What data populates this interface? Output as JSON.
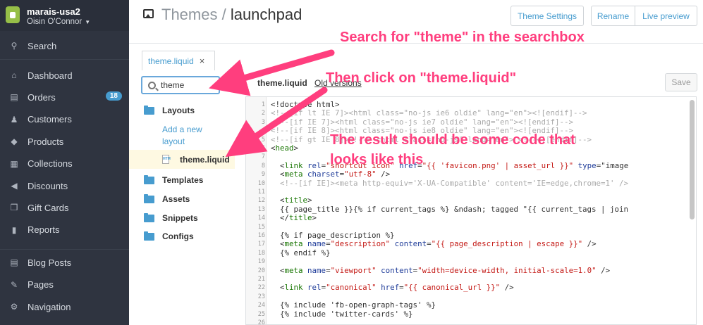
{
  "store": {
    "name": "marais-usa2",
    "user": "Oisin O'Connor"
  },
  "sidebar": {
    "search": "Search",
    "items": [
      {
        "label": "Dashboard",
        "icon": "home-icon"
      },
      {
        "label": "Orders",
        "icon": "orders-icon",
        "badge": "18"
      },
      {
        "label": "Customers",
        "icon": "customers-icon"
      },
      {
        "label": "Products",
        "icon": "tag-icon"
      },
      {
        "label": "Collections",
        "icon": "collections-icon"
      },
      {
        "label": "Discounts",
        "icon": "megaphone-icon"
      },
      {
        "label": "Gift Cards",
        "icon": "gift-icon"
      },
      {
        "label": "Reports",
        "icon": "bar-chart-icon"
      }
    ],
    "items2": [
      {
        "label": "Blog Posts",
        "icon": "blog-icon"
      },
      {
        "label": "Pages",
        "icon": "pages-icon"
      },
      {
        "label": "Navigation",
        "icon": "navigation-icon"
      }
    ]
  },
  "header": {
    "title_main": "Themes",
    "title_sep": " / ",
    "title_sub": "launchpad",
    "theme_settings": "Theme Settings",
    "rename": "Rename",
    "live_preview": "Live preview"
  },
  "tabs": {
    "active": "theme.liquid",
    "close": "×"
  },
  "browser": {
    "search_value": "theme",
    "layouts": "Layouts",
    "add_layout": "Add a new layout",
    "file": "theme.liquid",
    "templates": "Templates",
    "assets": "Assets",
    "snippets": "Snippets",
    "configs": "Configs"
  },
  "editor": {
    "file": "theme.liquid",
    "old_versions": "Old versions",
    "save": "Save"
  },
  "code_lines": [
    {
      "n": "1",
      "t": "<!doctype html>"
    },
    {
      "n": "2",
      "t": "<!--[if lt IE 7]><html class=\"no-js ie6 oldie\" lang=\"en\"><![endif]-->"
    },
    {
      "n": "3",
      "t": "<!--[if IE 7]><html class=\"no-js ie7 oldie\" lang=\"en\"><![endif]-->"
    },
    {
      "n": "4",
      "t": "<!--[if IE 8]><html class=\"no-js ie8 oldie\" lang=\"en\"><![endif]-->"
    },
    {
      "n": "5",
      "t": "<!--[if gt IE 8]><!--> <html class=\"no-js\" lang=\"en\"> <!--<![endif]-->"
    },
    {
      "n": "6",
      "t": "<head>"
    },
    {
      "n": "7",
      "t": ""
    },
    {
      "n": "8",
      "t": "  <link rel=\"shortcut icon\" href=\"{{ 'favicon.png' | asset_url }}\" type=\"image"
    },
    {
      "n": "9",
      "t": "  <meta charset=\"utf-8\" />"
    },
    {
      "n": "10",
      "t": "  <!--[if IE]><meta http-equiv='X-UA-Compatible' content='IE=edge,chrome=1' />"
    },
    {
      "n": "11",
      "t": ""
    },
    {
      "n": "12",
      "t": "  <title>"
    },
    {
      "n": "13",
      "t": "  {{ page_title }}{% if current_tags %} &ndash; tagged \"{{ current_tags | join"
    },
    {
      "n": "14",
      "t": "  </title>"
    },
    {
      "n": "15",
      "t": ""
    },
    {
      "n": "16",
      "t": "  {% if page_description %}"
    },
    {
      "n": "17",
      "t": "  <meta name=\"description\" content=\"{{ page_description | escape }}\" />"
    },
    {
      "n": "18",
      "t": "  {% endif %}"
    },
    {
      "n": "19",
      "t": ""
    },
    {
      "n": "20",
      "t": "  <meta name=\"viewport\" content=\"width=device-width, initial-scale=1.0\" />"
    },
    {
      "n": "21",
      "t": ""
    },
    {
      "n": "22",
      "t": "  <link rel=\"canonical\" href=\"{{ canonical_url }}\" />"
    },
    {
      "n": "23",
      "t": ""
    },
    {
      "n": "24",
      "t": "  {% include 'fb-open-graph-tags' %}"
    },
    {
      "n": "25",
      "t": "  {% include 'twitter-cards' %}"
    },
    {
      "n": "26",
      "t": ""
    }
  ],
  "annotations": {
    "a1": "Search for \"theme\" in the searchbox",
    "a2": "Then click on \"theme.liquid\"",
    "a3a": "The result should be some code that",
    "a3b": "looks like this"
  },
  "colors": {
    "annotation": "#ff3e7e",
    "sidebar": "#2f3440",
    "link": "#479ccf"
  }
}
